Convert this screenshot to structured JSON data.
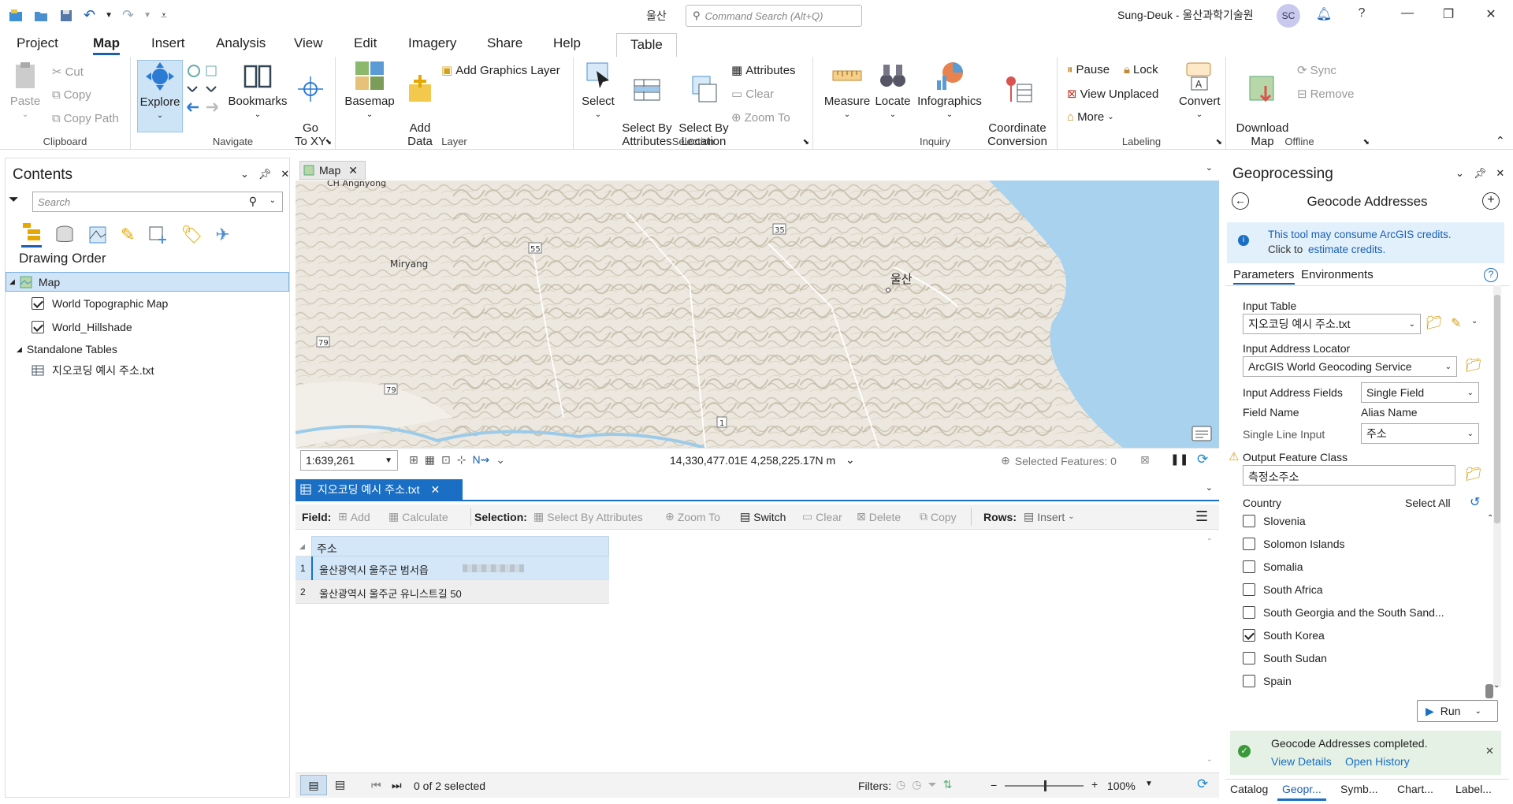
{
  "window": {
    "title": "울산",
    "search_placeholder": "Command Search (Alt+Q)",
    "user": "Sung-Deuk - 울산과학기술원",
    "avatar": "SC"
  },
  "tabs": [
    "Project",
    "Map",
    "Insert",
    "Analysis",
    "View",
    "Edit",
    "Imagery",
    "Share",
    "Help"
  ],
  "context_tab": "Table",
  "ribbon": {
    "clipboard": {
      "label": "Clipboard",
      "paste": "Paste",
      "cut": "Cut",
      "copy": "Copy",
      "copy_path": "Copy Path"
    },
    "navigate": {
      "label": "Navigate",
      "explore": "Explore",
      "bookmarks": "Bookmarks",
      "goto": "Go\nTo XY"
    },
    "layer": {
      "label": "Layer",
      "basemap": "Basemap",
      "add_data": "Add\nData",
      "add_graphics": "Add Graphics Layer"
    },
    "selection": {
      "label": "Selection",
      "select": "Select",
      "select_by_attr": "Select By\nAttributes",
      "select_by_loc": "Select By\nLocation",
      "attributes": "Attributes",
      "clear": "Clear",
      "zoom_to": "Zoom To"
    },
    "inquiry": {
      "label": "Inquiry",
      "measure": "Measure",
      "locate": "Locate",
      "infographics": "Infographics",
      "coord": "Coordinate\nConversion"
    },
    "labeling": {
      "label": "Labeling",
      "pause": "Pause",
      "lock": "Lock",
      "view_unplaced": "View Unplaced",
      "more": "More",
      "convert": "Convert"
    },
    "offline": {
      "label": "Offline",
      "download": "Download\nMap",
      "sync": "Sync",
      "remove": "Remove"
    }
  },
  "contents": {
    "title": "Contents",
    "search_placeholder": "Search",
    "drawing_order": "Drawing Order",
    "map": "Map",
    "layers": [
      "World Topographic Map",
      "World_Hillshade"
    ],
    "standalone": "Standalone Tables",
    "table": "지오코딩 예시 주소.txt"
  },
  "map": {
    "tab": "Map",
    "labels": {
      "ch": "CH Angnyong",
      "miryang": "Miryang",
      "ulsan": "울산",
      "r55": "55",
      "r35": "35",
      "r79a": "79",
      "r79b": "79",
      "r1": "1"
    },
    "scale": "1:639,261",
    "coords": "14,330,477.01E 4,258,225.17N m",
    "selected": "Selected Features: 0"
  },
  "table": {
    "tab": "지오코딩 예시 주소.txt",
    "field": "Field:",
    "add": "Add",
    "calculate": "Calculate",
    "selection": "Selection:",
    "sel_by_attr": "Select By Attributes",
    "zoom_to": "Zoom To",
    "switch": "Switch",
    "clear": "Clear",
    "delete": "Delete",
    "copy": "Copy",
    "rows": "Rows:",
    "insert": "Insert",
    "column": "주소",
    "rows_data": [
      {
        "n": "1",
        "v": "울산광역시 울주군 범서읍"
      },
      {
        "n": "2",
        "v": "울산광역시 울주군 유니스트길 50"
      }
    ],
    "status": "0 of 2 selected",
    "filters": "Filters:",
    "zoom": "100%"
  },
  "geo": {
    "title": "Geoprocessing",
    "tool": "Geocode Addresses",
    "info1": "This tool may consume ArcGIS credits.",
    "info2": "Click to",
    "info_link": "estimate credits.",
    "tab_params": "Parameters",
    "tab_env": "Environments",
    "input_table_label": "Input Table",
    "input_table": "지오코딩 예시 주소.txt",
    "locator_label": "Input Address Locator",
    "locator": "ArcGIS World Geocoding Service",
    "fields_label": "Input Address Fields",
    "fields": "Single Field",
    "field_name": "Field Name",
    "alias_name": "Alias Name",
    "single_line": "Single Line Input",
    "alias": "주소",
    "output_label": "Output Feature Class",
    "output": "측정소주소",
    "country_label": "Country",
    "select_all": "Select All",
    "countries": [
      {
        "name": "Slovenia",
        "on": false
      },
      {
        "name": "Solomon Islands",
        "on": false
      },
      {
        "name": "Somalia",
        "on": false
      },
      {
        "name": "South Africa",
        "on": false
      },
      {
        "name": "South Georgia and the South Sand...",
        "on": false
      },
      {
        "name": "South Korea",
        "on": true
      },
      {
        "name": "South Sudan",
        "on": false
      },
      {
        "name": "Spain",
        "on": false
      }
    ],
    "run": "Run",
    "done": "Geocode Addresses completed.",
    "view_details": "View Details",
    "open_history": "Open History",
    "bottom_tabs": [
      "Catalog",
      "Geopr...",
      "Symb...",
      "Chart...",
      "Label..."
    ]
  }
}
